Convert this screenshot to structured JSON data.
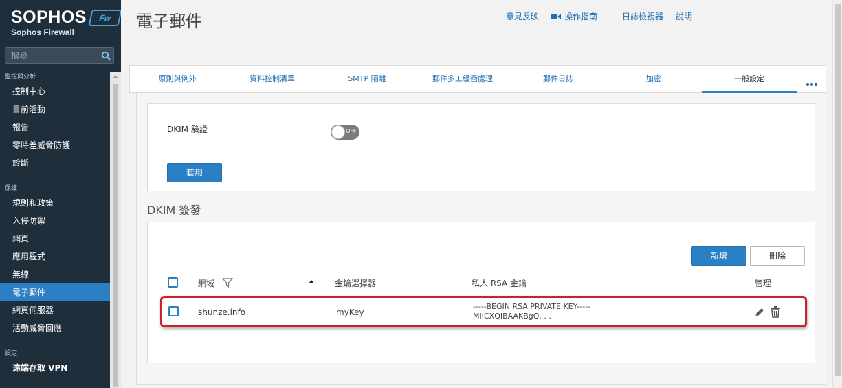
{
  "brand": {
    "logo": "SOPHOS",
    "badge": "Fw",
    "product": "Sophos Firewall"
  },
  "sidebar": {
    "search_placeholder": "搜尋",
    "sections": [
      {
        "title": "監控與分析",
        "items": [
          "控制中心",
          "目前活動",
          "報告",
          "零時差威脅防護",
          "診斷"
        ]
      },
      {
        "title": "保護",
        "items": [
          "規則和政策",
          "入侵防禦",
          "網頁",
          "應用程式",
          "無線",
          "電子郵件",
          "網頁伺服器",
          "活動威脅回應"
        ]
      },
      {
        "title": "設定",
        "items": [
          "遠端存取 VPN"
        ]
      }
    ],
    "active_item": "電子郵件"
  },
  "header": {
    "title": "電子郵件",
    "links": [
      "意見反映",
      "操作指南",
      "日誌檢視器",
      "說明"
    ]
  },
  "tabs": [
    "原則與例外",
    "資料控制清單",
    "SMTP 隔離",
    "郵件多工緩衝處理",
    "郵件日誌",
    "加密",
    "一般設定"
  ],
  "active_tab": "一般設定",
  "dkim_verify": {
    "label": "DKIM 驗證",
    "toggle_state": "OFF",
    "apply_label": "套用"
  },
  "dkim_sign": {
    "title": "DKIM 簽發",
    "add_label": "新增",
    "delete_label": "刪除",
    "columns": [
      "網域",
      "金鑰選擇器",
      "私人 RSA 金鑰",
      "管理"
    ],
    "rows": [
      {
        "domain": "shunze.info",
        "selector": "myKey",
        "key_line1": "-----BEGIN RSA PRIVATE KEY-----",
        "key_line2": "MIICXQIBAAKBgQ. . ."
      }
    ]
  },
  "colors": {
    "sidebar_bg": "#1f2e3b",
    "accent": "#2b7fc4",
    "highlight_border": "#c8232a"
  }
}
